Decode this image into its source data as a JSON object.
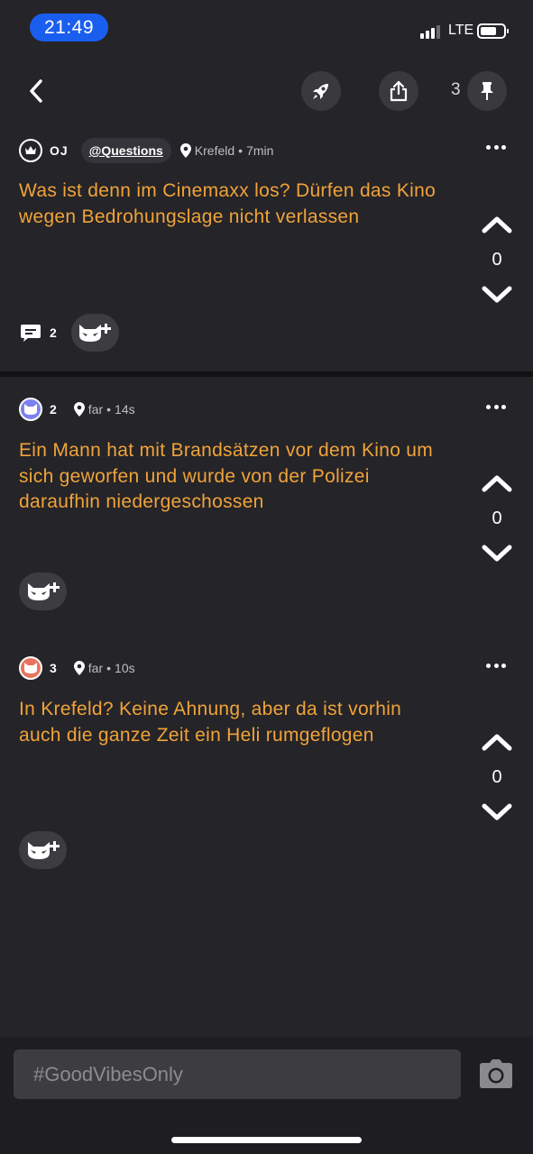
{
  "status_bar": {
    "time": "21:49",
    "network": "LTE"
  },
  "nav": {
    "pin_count": "3"
  },
  "posts": [
    {
      "author": "OJ",
      "channel": "@Questions",
      "location": "Krefeld",
      "time": "7min",
      "text": "Was ist denn im Cinemaxx los? Dürfen das Kino wegen Bedrohungslage nicht verlassen",
      "votes": "0",
      "comments": "2"
    },
    {
      "author": "2",
      "location": "far",
      "time": "14s",
      "text": "Ein Mann hat mit Brandsätzen vor dem Kino um sich geworfen und wurde von der Polizei daraufhin niedergeschossen",
      "votes": "0"
    },
    {
      "author": "3",
      "location": "far",
      "time": "10s",
      "text": "In Krefeld? Keine Ahnung, aber da ist vorhin auch die ganze Zeit ein Heli rumgeflogen",
      "votes": "0"
    }
  ],
  "compose": {
    "placeholder": "#GoodVibesOnly"
  },
  "colors": {
    "accent_text": "#f0a33a",
    "background": "#252428",
    "time_pill": "#1a5ef0",
    "avatar_blue": "#7b82f0",
    "avatar_red": "#e8735e"
  },
  "icons": [
    "back-icon",
    "rocket-icon",
    "share-icon",
    "pin-icon",
    "crown-icon",
    "location-icon",
    "more-icon",
    "upvote-icon",
    "downvote-icon",
    "comment-icon",
    "add-reaction-icon",
    "camera-icon"
  ]
}
